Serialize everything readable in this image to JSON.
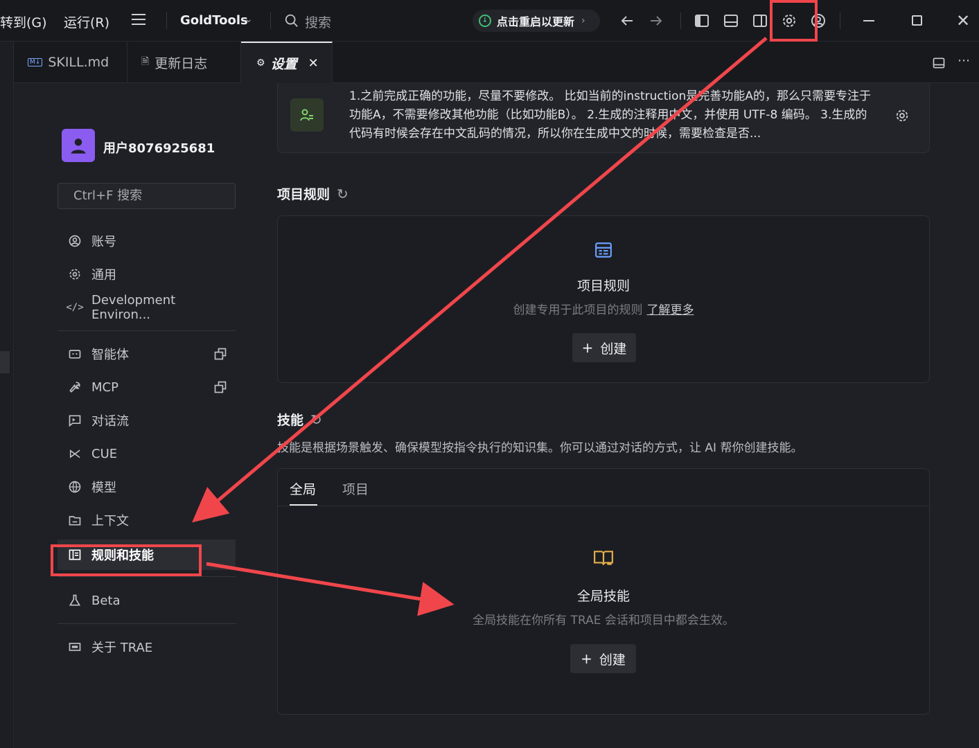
{
  "titlebar": {
    "menu_goto": "转到(G)",
    "menu_run": "运行(R)",
    "project_name": "GoldTools",
    "search_placeholder": "搜索",
    "update_label": "点击重启以更新"
  },
  "tabs": [
    {
      "label": "SKILL.md"
    },
    {
      "label": "更新日志"
    },
    {
      "label": "设置"
    }
  ],
  "sidebar": {
    "username": "用户8076925681",
    "search_placeholder": "Ctrl+F 搜索",
    "items": [
      {
        "label": "账号",
        "icon": "account-icon"
      },
      {
        "label": "通用",
        "icon": "gear-icon"
      },
      {
        "label": "Development Environ...",
        "icon": "code-icon"
      },
      {
        "label": "智能体",
        "icon": "agent-icon"
      },
      {
        "label": "MCP",
        "icon": "wrench-icon"
      },
      {
        "label": "对话流",
        "icon": "chat-flow-icon"
      },
      {
        "label": "CUE",
        "icon": "cue-icon"
      },
      {
        "label": "模型",
        "icon": "model-icon"
      },
      {
        "label": "上下文",
        "icon": "context-icon"
      },
      {
        "label": "规则和技能",
        "icon": "rules-icon",
        "active": true
      },
      {
        "label": "Beta",
        "icon": "flask-icon"
      },
      {
        "label": "关于 TRAE",
        "icon": "about-icon"
      }
    ]
  },
  "main": {
    "personal_rule_text": "1.之前完成正确的功能，尽量不要修改。 比如当前的instruction是完善功能A的，那么只需要专注于功能A，不需要修改其他功能（比如功能B）。 2.生成的注释用中文，并使用 UTF-8 编码。 3.生成的代码有时候会存在中文乱码的情况，所以你在生成中文的时候，需要检查是否...",
    "project_rules": {
      "title": "项目规则",
      "empty_title": "项目规则",
      "empty_desc": "创建专用于此项目的规则",
      "learn_more": "了解更多",
      "create_label": "创建"
    },
    "skills": {
      "title": "技能",
      "desc": "技能是根据场景触发、确保模型按指令执行的知识集。你可以通过对话的方式，让 AI 帮你创建技能。",
      "tabs": [
        "全局",
        "项目"
      ],
      "empty_title": "全局技能",
      "empty_desc": "全局技能在你所有 TRAE 会话和项目中都会生效。",
      "create_label": "创建"
    }
  },
  "colors": {
    "accent_annotation": "#f0464b",
    "update_green": "#3fbf75",
    "avatar_purple": "#8a5cf0"
  }
}
